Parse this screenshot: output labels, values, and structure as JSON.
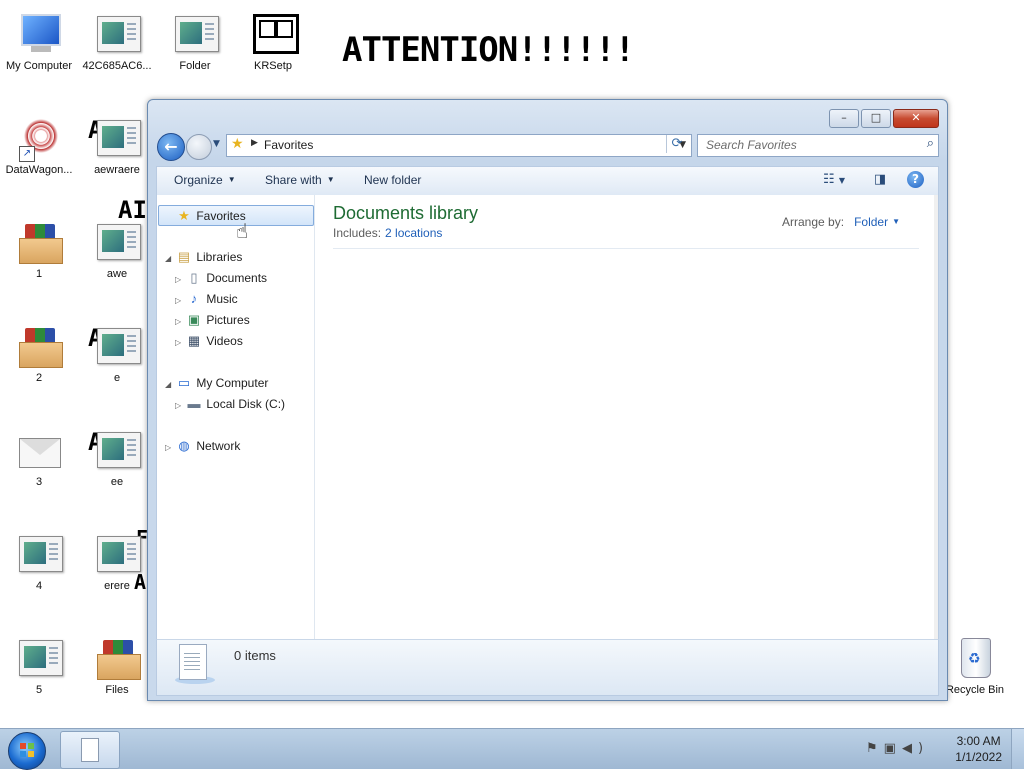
{
  "desktop": {
    "banner": "ATTENTION!!!!!!",
    "fragments": [
      "A",
      "AI",
      "A",
      "A",
      "F",
      "A"
    ],
    "icons": {
      "my_computer": "My Computer",
      "hex_file": "42C685AC6...",
      "folder": "Folder",
      "krsetp": "KRSetp",
      "datawagon": "DataWagon...",
      "aewraere": "aewraere",
      "one": "1",
      "awe": "awe",
      "two": "2",
      "e": "e",
      "three": "3",
      "ee": "ee",
      "four": "4",
      "erere": "erere",
      "five": "5",
      "files": "Files",
      "recycle_bin": "Recycle Bin"
    }
  },
  "window": {
    "controls": {
      "minimize": "–",
      "maximize": "□",
      "close": "✕"
    },
    "address": {
      "location": "Favorites"
    },
    "search": {
      "placeholder": "Search Favorites"
    },
    "toolbar": {
      "organize": "Organize",
      "share_with": "Share with",
      "new_folder": "New folder",
      "help": "?"
    },
    "nav": {
      "favorites": "Favorites",
      "libraries": "Libraries",
      "documents": "Documents",
      "music": "Music",
      "pictures": "Pictures",
      "videos": "Videos",
      "my_computer": "My Computer",
      "local_disk": "Local Disk (C:)",
      "network": "Network"
    },
    "content": {
      "title": "Documents library",
      "includes_label": "Includes:",
      "includes_link": "2 locations",
      "arrange_label": "Arrange by:",
      "arrange_value": "Folder"
    },
    "details": {
      "count": "0 items"
    }
  },
  "taskbar": {
    "time": "3:00 AM",
    "date": "1/1/2022"
  },
  "colors": {
    "library_title": "#1e6b33",
    "link": "#1f5fb8",
    "close_button": "#c74b30"
  }
}
